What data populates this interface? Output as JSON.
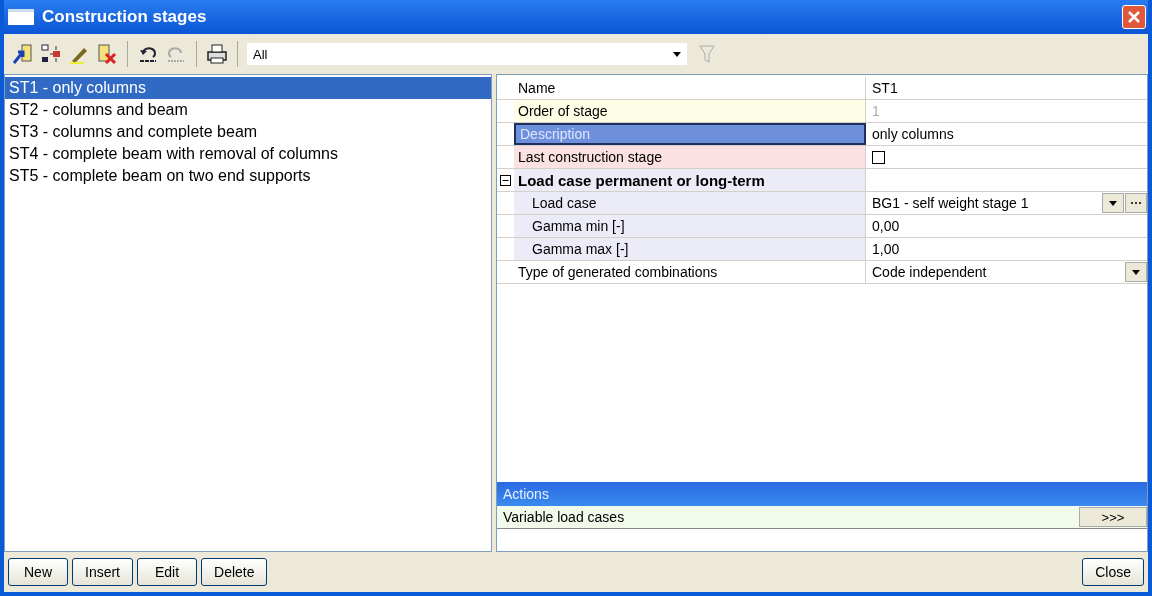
{
  "window": {
    "title": "Construction stages"
  },
  "toolbar": {
    "filter": {
      "value": "All"
    }
  },
  "stages": [
    {
      "label": "ST1 - only columns",
      "selected": true
    },
    {
      "label": "ST2 - columns and beam",
      "selected": false
    },
    {
      "label": "ST3 - columns and complete beam",
      "selected": false
    },
    {
      "label": "ST4 - complete beam with removal of columns",
      "selected": false
    },
    {
      "label": "ST5 - complete beam on two end supports",
      "selected": false
    }
  ],
  "properties": [
    {
      "kind": "text",
      "label": "Name",
      "value": "ST1",
      "color": "#ffffff",
      "selected": false
    },
    {
      "kind": "text",
      "label": "Order of stage",
      "value": "1",
      "color": "#fefee6",
      "selected": false,
      "disabled": true
    },
    {
      "kind": "text",
      "label": "Description",
      "value": "only columns",
      "selected": true
    },
    {
      "kind": "checkbox",
      "label": "Last construction stage",
      "checked": false,
      "color": "#fbe1e1",
      "selected": false
    },
    {
      "kind": "group",
      "label": "Load case permanent or long-term",
      "expanded": true,
      "children": [
        {
          "kind": "dropdown",
          "label": "Load case",
          "value": "BG1 - self weight stage 1",
          "ellipsis": true,
          "color": "#ececf8",
          "selected": false
        },
        {
          "kind": "text",
          "label": "Gamma min [-]",
          "value": "0,00",
          "color": "#ececf8",
          "selected": false
        },
        {
          "kind": "text",
          "label": "Gamma max [-]",
          "value": "1,00",
          "color": "#ececf8",
          "selected": false
        }
      ]
    },
    {
      "kind": "dropdown",
      "label": "Type of generated combinations",
      "value": "Code independent",
      "color": "#ffffff",
      "selected": false
    }
  ],
  "actions": {
    "title": "Actions",
    "items": [
      {
        "label": "Variable load cases",
        "button": ">>>"
      }
    ]
  },
  "buttons": [
    "New",
    "Insert",
    "Edit",
    "Delete"
  ],
  "close_button": "Close"
}
